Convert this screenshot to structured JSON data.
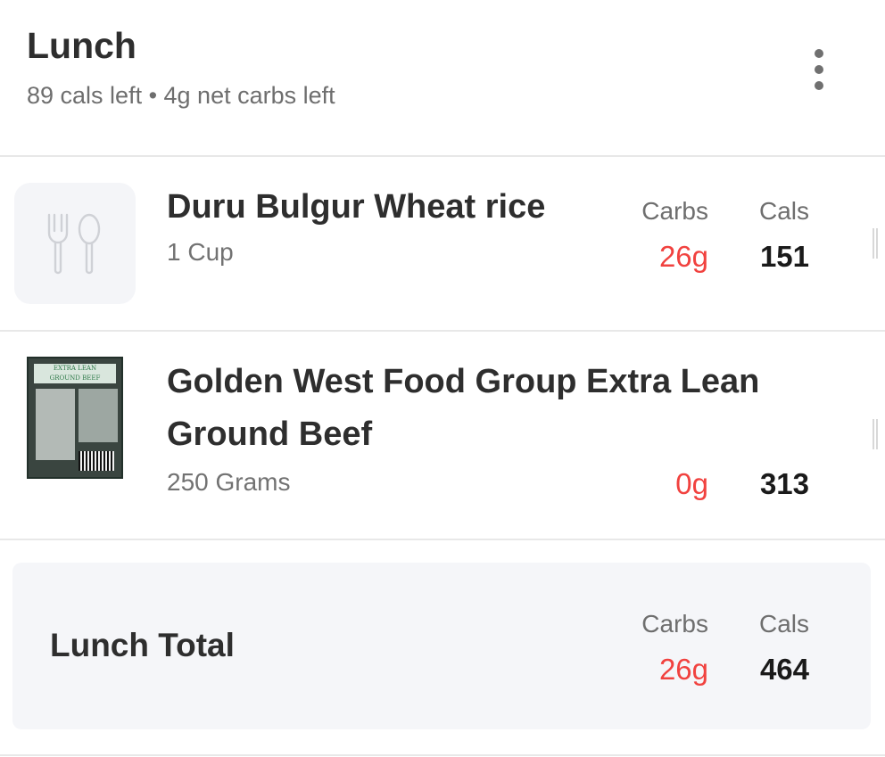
{
  "meal": {
    "title": "Lunch",
    "summary": "89 cals left • 4g net carbs left",
    "more_icon": "more-vertical-icon"
  },
  "columns": {
    "carbs": "Carbs",
    "cals": "Cals"
  },
  "items": [
    {
      "name": "Duru Bulgur Wheat rice",
      "quantity": "1 Cup",
      "carbs": "26g",
      "cals": "151",
      "thumbnail_icon": "fork-spoon-icon"
    },
    {
      "name_line1": "Golden West Food Group Extra Lean",
      "name_line2": "Ground Beef",
      "quantity": "250 Grams",
      "carbs": "0g",
      "cals": "313",
      "photo_label_1": "EXTRA LEAN",
      "photo_label_2": "GROUND BEEF"
    }
  ],
  "total": {
    "label": "Lunch Total",
    "carbs": "26g",
    "cals": "464"
  },
  "colors": {
    "carbs_accent": "#f1423f",
    "card_bg": "#f5f6f9",
    "divider": "#e8e8e8"
  }
}
